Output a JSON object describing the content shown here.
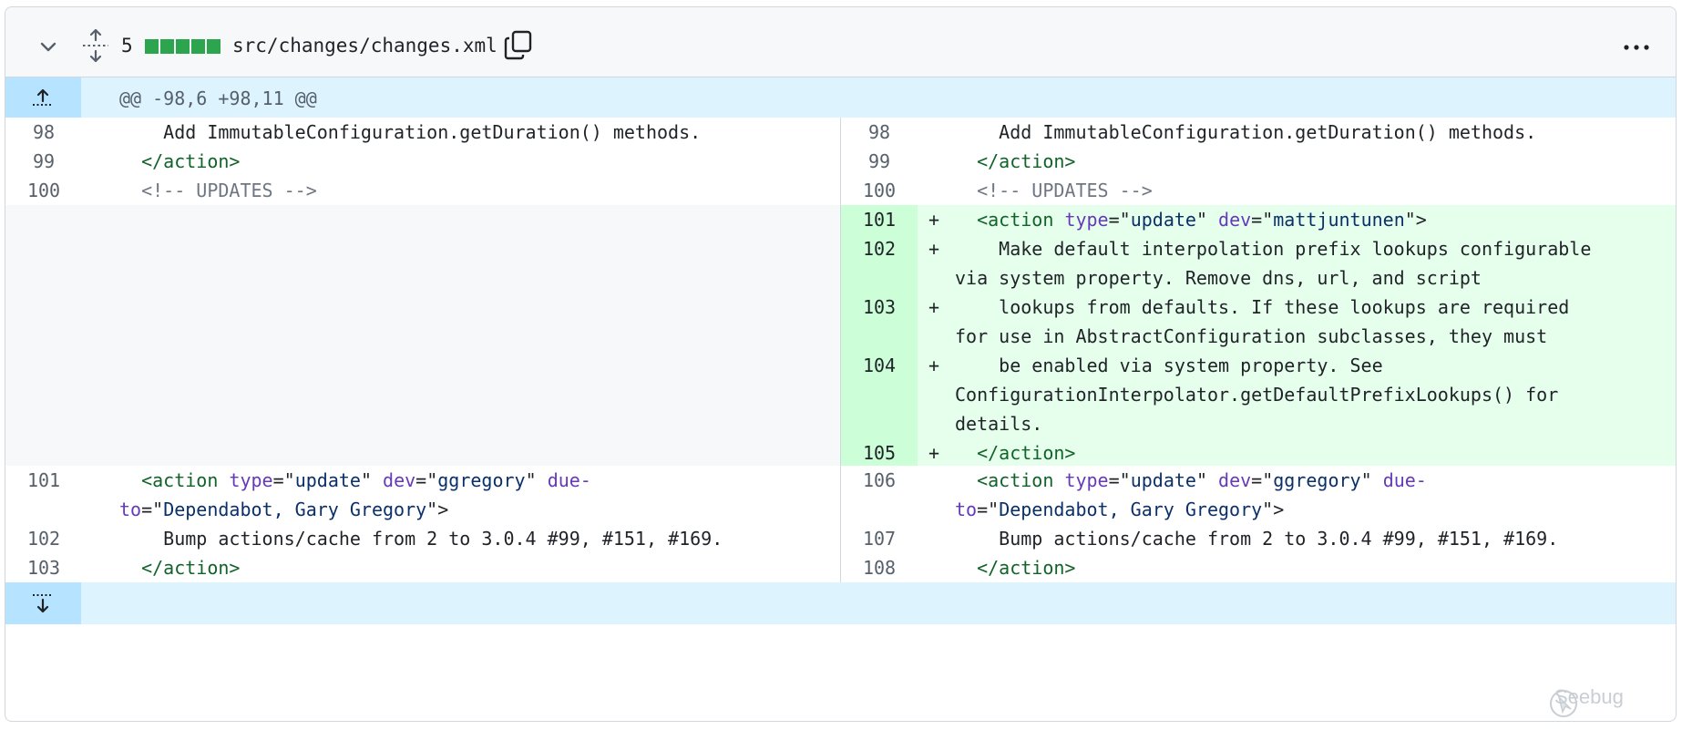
{
  "file_header": {
    "changes_count": "5",
    "file_path": "src/changes/changes.xml"
  },
  "hunk_top": "@@ -98,6 +98,11 @@",
  "left": {
    "n98": "98",
    "n99": "99",
    "n100": "100",
    "n101": "101",
    "n102": "102",
    "n103": "103"
  },
  "right": {
    "n98": "98",
    "n99": "99",
    "n100": "100",
    "n101": "101",
    "n102": "102",
    "n103": "103",
    "n104": "104",
    "n105": "105",
    "n106": "106",
    "n107": "107",
    "n108": "108"
  },
  "code": {
    "line_add_methods": "Add ImmutableConfiguration.getDuration() methods.",
    "close_action": "</action>",
    "comment_updates": "<!-- UPDATES -->",
    "action_open": "<action",
    "attr_type": "type",
    "eq_q": "=\"",
    "val_update": "update",
    "q_sp": "\" ",
    "attr_dev": "dev",
    "val_matt": "mattjuntunen",
    "q_gt": "\">",
    "val_ggregory": "ggregory",
    "attr_due": "due-",
    "attr_to": "to",
    "val_dependabot": "Dependabot, Gary Gregory",
    "added_102a": "Make default interpolation prefix lookups configurable",
    "added_102b": "via system property. Remove dns, url, and script",
    "added_103a": "lookups from defaults. If these lookups are required",
    "added_103b": "for use in AbstractConfiguration subclasses, they must",
    "added_104a": "be enabled via system property. See",
    "added_104b": "ConfigurationInterpolator.getDefaultPrefixLookups() for",
    "added_104c": "details.",
    "bump": "Bump actions/cache from 2 to 3.0.4 #99, #151, #169.",
    "plus": "+"
  },
  "watermark": "Seebug",
  "colors": {
    "addition_bg": "#e6ffec",
    "addition_gutter": "#ccffd8",
    "hunk_bg": "#ddf4ff",
    "hunk_gutter": "#b6e3ff",
    "diffstat_green": "#2da44e"
  },
  "icons": [
    "chevron-down-icon",
    "expand-all-icon",
    "copy-icon",
    "kebab-icon",
    "expand-up-icon",
    "expand-down-icon"
  ]
}
